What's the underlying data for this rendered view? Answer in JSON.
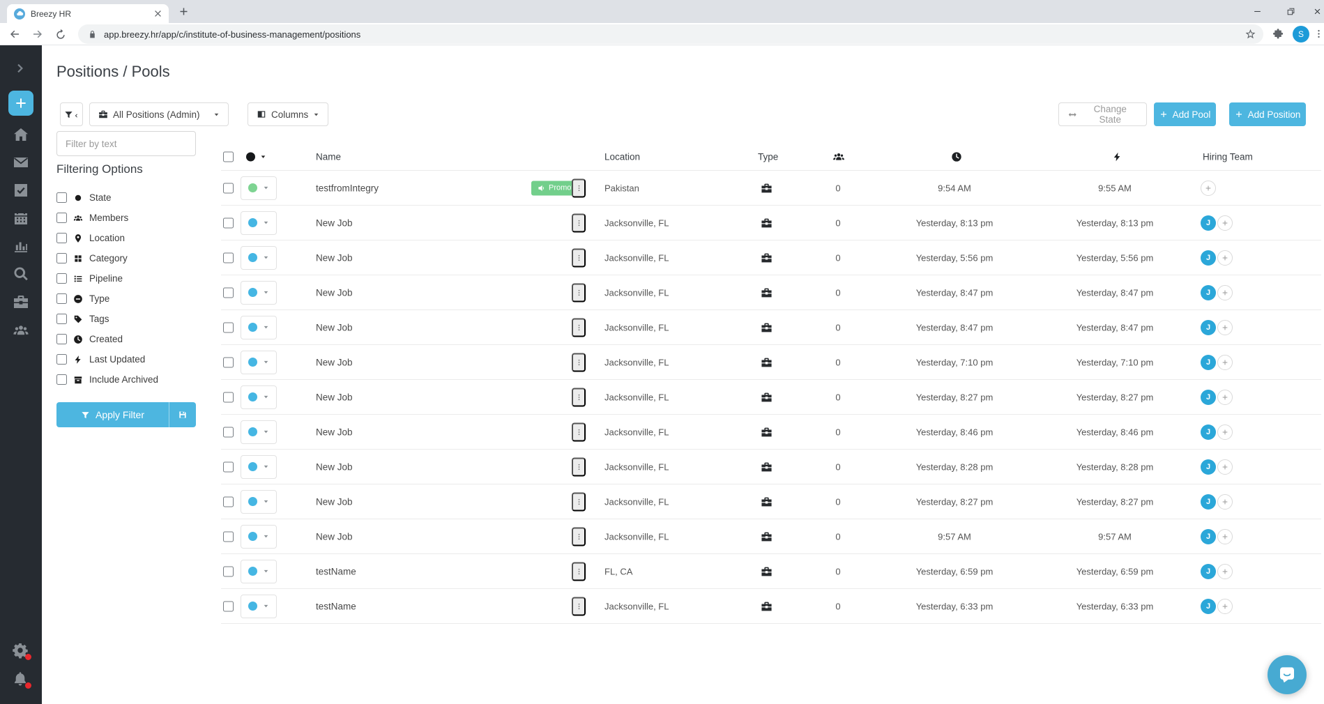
{
  "browser": {
    "tab_title": "Breezy HR",
    "url": "app.breezy.hr/app/c/institute-of-business-management/positions",
    "profile_initial": "S"
  },
  "sidebar": {
    "items": [
      {
        "name": "expand",
        "icon": "chevron-right-icon",
        "active": false
      },
      {
        "name": "quick-add",
        "icon": "plus-icon",
        "active": true
      },
      {
        "name": "home",
        "icon": "home-icon",
        "active": false
      },
      {
        "name": "inbox",
        "icon": "mail-icon",
        "active": false
      },
      {
        "name": "tasks",
        "icon": "check-square-icon",
        "active": false
      },
      {
        "name": "calendar",
        "icon": "calendar-icon",
        "active": false
      },
      {
        "name": "reports",
        "icon": "chart-icon",
        "active": false
      },
      {
        "name": "search",
        "icon": "search-icon",
        "active": false
      },
      {
        "name": "positions",
        "icon": "briefcase-icon",
        "active": false
      },
      {
        "name": "candidates",
        "icon": "people-icon",
        "active": false
      }
    ],
    "bottom_items": [
      {
        "name": "settings",
        "icon": "gear-icon",
        "badge": true
      },
      {
        "name": "notifications",
        "icon": "bell-icon",
        "badge": true
      }
    ]
  },
  "page": {
    "title": "Positions / Pools"
  },
  "toolbar": {
    "view_dropdown_label": "All Positions (Admin)",
    "columns_label": "Columns",
    "change_state_label": "Change State",
    "add_pool_label": "Add Pool",
    "add_position_label": "Add Position"
  },
  "filter_panel": {
    "text_placeholder": "Filter by text",
    "heading": "Filtering Options",
    "apply_label": "Apply Filter",
    "options": [
      {
        "label": "State",
        "icon": "circle-icon"
      },
      {
        "label": "Members",
        "icon": "people-icon"
      },
      {
        "label": "Location",
        "icon": "pin-icon"
      },
      {
        "label": "Category",
        "icon": "grid-icon"
      },
      {
        "label": "Pipeline",
        "icon": "list-icon"
      },
      {
        "label": "Type",
        "icon": "type-icon"
      },
      {
        "label": "Tags",
        "icon": "tag-icon"
      },
      {
        "label": "Created",
        "icon": "clock-icon"
      },
      {
        "label": "Last Updated",
        "icon": "bolt-icon"
      },
      {
        "label": "Include Archived",
        "icon": "archive-icon"
      }
    ]
  },
  "table": {
    "headers": {
      "name": "Name",
      "location": "Location",
      "type": "Type",
      "hiring_team": "Hiring Team"
    },
    "promote_label": "Promote",
    "rows": [
      {
        "name": "testfromIntegry",
        "promote": true,
        "location": "Pakistan",
        "count": "0",
        "created": "9:54 AM",
        "updated": "9:55 AM",
        "state_color": "#7ed492",
        "avatar": null
      },
      {
        "name": "New Job",
        "promote": false,
        "location": "Jacksonville, FL",
        "count": "0",
        "created": "Yesterday, 8:13 pm",
        "updated": "Yesterday, 8:13 pm",
        "state_color": "#45b6e3",
        "avatar": "J"
      },
      {
        "name": "New Job",
        "promote": false,
        "location": "Jacksonville, FL",
        "count": "0",
        "created": "Yesterday, 5:56 pm",
        "updated": "Yesterday, 5:56 pm",
        "state_color": "#45b6e3",
        "avatar": "J"
      },
      {
        "name": "New Job",
        "promote": false,
        "location": "Jacksonville, FL",
        "count": "0",
        "created": "Yesterday, 8:47 pm",
        "updated": "Yesterday, 8:47 pm",
        "state_color": "#45b6e3",
        "avatar": "J"
      },
      {
        "name": "New Job",
        "promote": false,
        "location": "Jacksonville, FL",
        "count": "0",
        "created": "Yesterday, 8:47 pm",
        "updated": "Yesterday, 8:47 pm",
        "state_color": "#45b6e3",
        "avatar": "J"
      },
      {
        "name": "New Job",
        "promote": false,
        "location": "Jacksonville, FL",
        "count": "0",
        "created": "Yesterday, 7:10 pm",
        "updated": "Yesterday, 7:10 pm",
        "state_color": "#45b6e3",
        "avatar": "J"
      },
      {
        "name": "New Job",
        "promote": false,
        "location": "Jacksonville, FL",
        "count": "0",
        "created": "Yesterday, 8:27 pm",
        "updated": "Yesterday, 8:27 pm",
        "state_color": "#45b6e3",
        "avatar": "J"
      },
      {
        "name": "New Job",
        "promote": false,
        "location": "Jacksonville, FL",
        "count": "0",
        "created": "Yesterday, 8:46 pm",
        "updated": "Yesterday, 8:46 pm",
        "state_color": "#45b6e3",
        "avatar": "J"
      },
      {
        "name": "New Job",
        "promote": false,
        "location": "Jacksonville, FL",
        "count": "0",
        "created": "Yesterday, 8:28 pm",
        "updated": "Yesterday, 8:28 pm",
        "state_color": "#45b6e3",
        "avatar": "J"
      },
      {
        "name": "New Job",
        "promote": false,
        "location": "Jacksonville, FL",
        "count": "0",
        "created": "Yesterday, 8:27 pm",
        "updated": "Yesterday, 8:27 pm",
        "state_color": "#45b6e3",
        "avatar": "J"
      },
      {
        "name": "New Job",
        "promote": false,
        "location": "Jacksonville, FL",
        "count": "0",
        "created": "9:57 AM",
        "updated": "9:57 AM",
        "state_color": "#45b6e3",
        "avatar": "J"
      },
      {
        "name": "testName",
        "promote": false,
        "location": "FL, CA",
        "count": "0",
        "created": "Yesterday, 6:59 pm",
        "updated": "Yesterday, 6:59 pm",
        "state_color": "#45b6e3",
        "avatar": "J"
      },
      {
        "name": "testName",
        "promote": false,
        "location": "Jacksonville, FL",
        "count": "0",
        "created": "Yesterday, 6:33 pm",
        "updated": "Yesterday, 6:33 pm",
        "state_color": "#45b6e3",
        "avatar": "J"
      }
    ]
  },
  "colors": {
    "accent": "#4db6e0",
    "state_green": "#7ed492",
    "state_blue": "#45b6e3",
    "promote_green": "#72cf8b",
    "avatar_blue": "#2ba7d9",
    "sidebar_bg": "#262b31",
    "notification_red": "#e8282d"
  }
}
